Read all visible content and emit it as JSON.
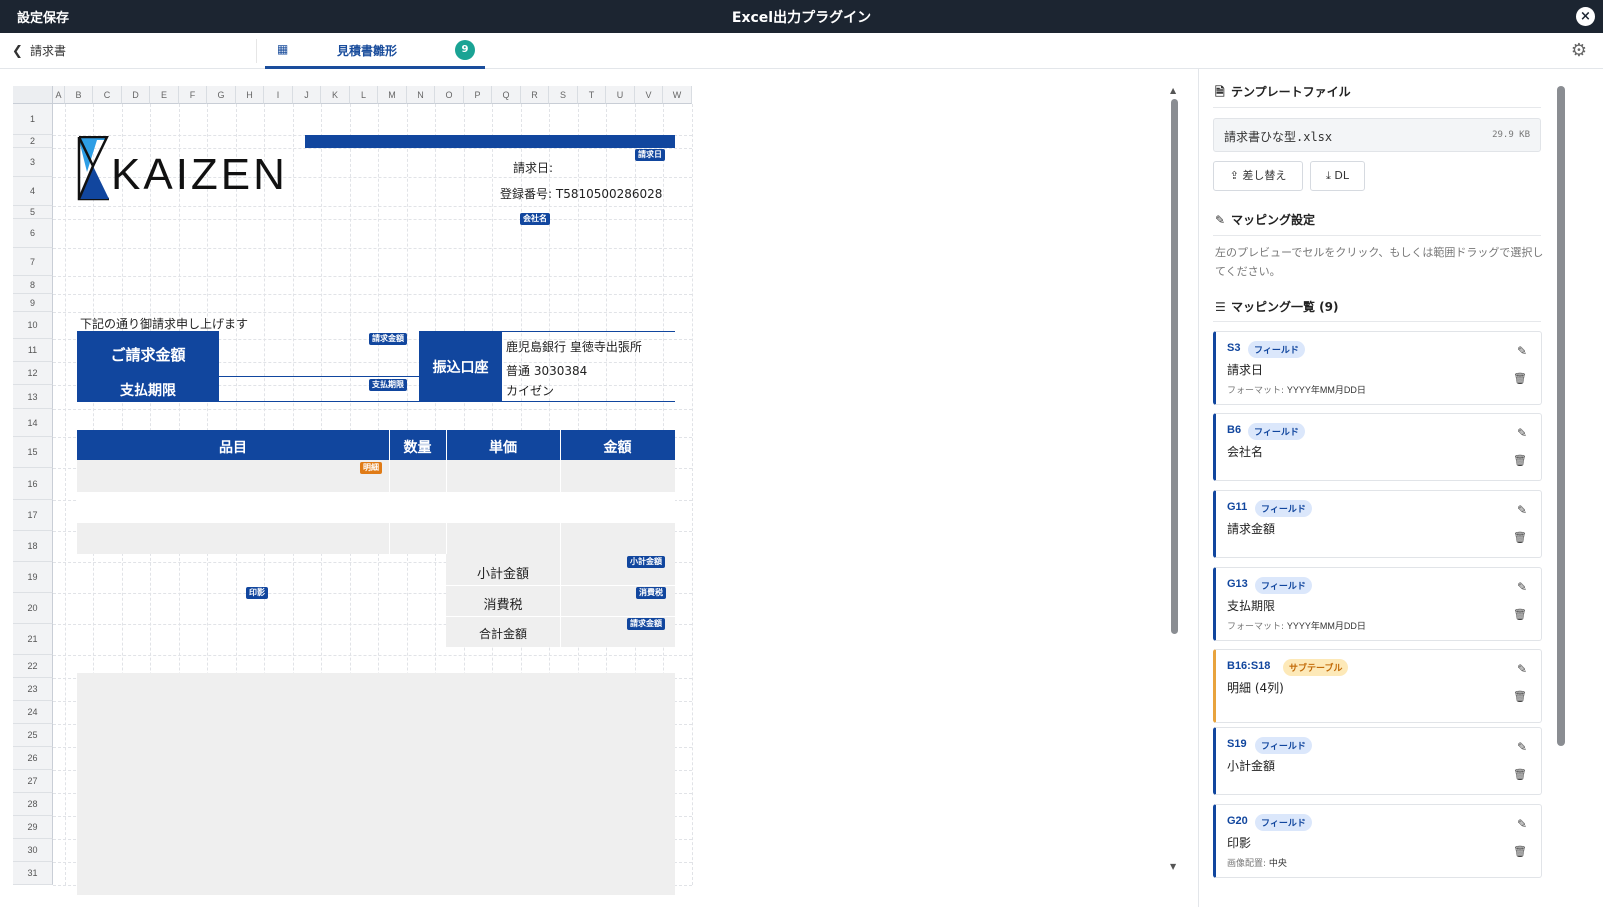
{
  "titlebar": {
    "save_label": "設定保存",
    "title": "Excel出力プラグイン",
    "close_icon": "×"
  },
  "navbar": {
    "back_label": "請求書",
    "tab_label": "見積書雛形",
    "tab_count": "9"
  },
  "sheet": {
    "columns": [
      "A",
      "B",
      "C",
      "D",
      "E",
      "F",
      "G",
      "H",
      "I",
      "J",
      "K",
      "L",
      "M",
      "N",
      "O",
      "P",
      "Q",
      "R",
      "S",
      "T",
      "U",
      "V",
      "W"
    ],
    "rows": [
      "1",
      "2",
      "3",
      "4",
      "5",
      "6",
      "7",
      "8",
      "9",
      "10",
      "11",
      "12",
      "13",
      "14",
      "15",
      "16",
      "17",
      "18",
      "19",
      "20",
      "21",
      "22",
      "23",
      "24",
      "25",
      "26",
      "27",
      "28",
      "29",
      "30",
      "31"
    ],
    "logo_text": "KAIZEN",
    "invoice_date_label": "請求日:",
    "registration_label": "登録番号: T5810500286028",
    "intro_text": "下記の通り御請求申し上げます",
    "amount_label": "ご請求金額",
    "due_label": "支払期限",
    "bank_label": "振込口座",
    "bank_line1": "鹿児島銀行 皇徳寺出張所",
    "bank_line2": "普通 3030384",
    "bank_line3": "カイゼン",
    "col_item": "品目",
    "col_qty": "数量",
    "col_price": "単価",
    "col_amount": "金額",
    "subtotal_label": "小計金額",
    "tax_label": "消費税",
    "total_label": "合計金額",
    "tags": {
      "date": "請求日",
      "company": "会社名",
      "amount": "請求金額",
      "due": "支払期限",
      "detail": "明細",
      "subtotal": "小計金額",
      "tax": "消費税",
      "total": "請求金額",
      "seal": "印影"
    }
  },
  "panel": {
    "template_title": "テンプレートファイル",
    "file_name": "請求書ひな型.xlsx",
    "file_size": "29.9 KB",
    "replace_label": "差し替え",
    "download_label": "DL",
    "mapping_title": "マッピング設定",
    "mapping_desc": "左のプレビューでセルをクリック、もしくは範囲ドラッグで選択してください。",
    "list_title": "マッピング一覧 (9)",
    "mappings": [
      {
        "cell": "S3",
        "type": "フィールド",
        "name": "請求日",
        "detail_label": "フォーマット:",
        "detail_value": "YYYY年MM月DD日"
      },
      {
        "cell": "B6",
        "type": "フィールド",
        "name": "会社名",
        "detail_label": "",
        "detail_value": ""
      },
      {
        "cell": "G11",
        "type": "フィールド",
        "name": "請求金額",
        "detail_label": "",
        "detail_value": ""
      },
      {
        "cell": "G13",
        "type": "フィールド",
        "name": "支払期限",
        "detail_label": "フォーマット:",
        "detail_value": "YYYY年MM月DD日"
      },
      {
        "cell": "B16:S18",
        "type": "サブテーブル",
        "name": "明細 (4列)",
        "detail_label": "",
        "detail_value": ""
      },
      {
        "cell": "S19",
        "type": "フィールド",
        "name": "小計金額",
        "detail_label": "",
        "detail_value": ""
      },
      {
        "cell": "G20",
        "type": "フィールド",
        "name": "印影",
        "detail_label": "画像配置:",
        "detail_value": "中央"
      }
    ]
  },
  "colors": {
    "navy": "#11469e",
    "titlebar": "#1c2531",
    "accent_teal": "#1aa394",
    "orange": "#e07b16"
  }
}
